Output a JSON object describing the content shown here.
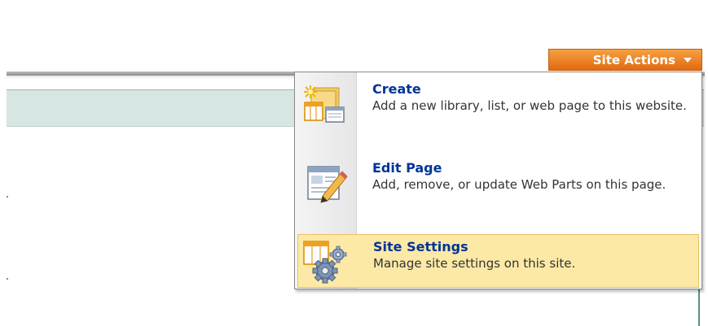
{
  "header": {
    "site_actions_label": "Site Actions"
  },
  "menu": {
    "items": [
      {
        "title": "Create",
        "description": "Add a new library, list, or web page to this website.",
        "icon": "create-icon"
      },
      {
        "title": "Edit Page",
        "description": "Add, remove, or update Web Parts on this page.",
        "icon": "edit-page-icon"
      },
      {
        "title": "Site Settings",
        "description": "Manage site settings on this site.",
        "icon": "site-settings-icon",
        "highlighted": true
      }
    ]
  },
  "colors": {
    "site_actions_bg": "#e26a10",
    "menu_title": "#003399",
    "menu_highlight": "#fce9a6",
    "teal_bar": "#d6e6e3"
  }
}
